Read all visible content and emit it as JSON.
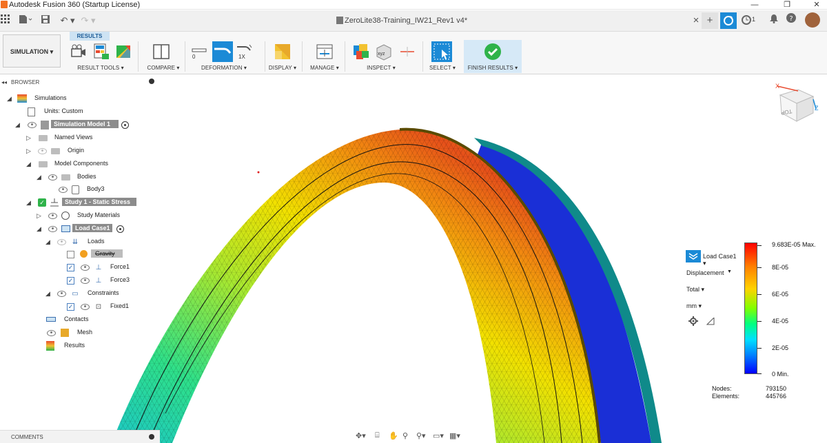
{
  "app": {
    "window_title": "Autodesk Fusion 360 (Startup License)",
    "doc_title": "ZeroLite38-Training_IW21_Rev1 v4*",
    "job_count": "1",
    "window_min": "—",
    "window_max": "❐",
    "window_close": "✕",
    "doc_close": "×",
    "doc_add": "+"
  },
  "ribbon": {
    "workspace": "SIMULATION ▾",
    "active_tab": "RESULTS",
    "groups": {
      "result_tools": "RESULT TOOLS ▾",
      "compare": "COMPARE ▾",
      "deformation": "DEFORMATION ▾",
      "display": "DISPLAY ▾",
      "manage": "MANAGE ▾",
      "inspect": "INSPECT ▾",
      "select": "SELECT ▾",
      "finish": "FINISH RESULTS ▾"
    },
    "deformation_zero": "0",
    "deformation_1x": "1X",
    "inspect_xyz": "xyz"
  },
  "browser": {
    "header": "BROWSER",
    "items": [
      {
        "label": "Simulations"
      },
      {
        "label": "Units: Custom"
      },
      {
        "label": "Simulation Model 1"
      },
      {
        "label": "Named Views"
      },
      {
        "label": "Origin"
      },
      {
        "label": "Model Components"
      },
      {
        "label": "Bodies"
      },
      {
        "label": "Body3"
      },
      {
        "label": "Study 1 - Static Stress"
      },
      {
        "label": "Study Materials"
      },
      {
        "label": "Load Case1"
      },
      {
        "label": "Loads"
      },
      {
        "label": "Gravity"
      },
      {
        "label": "Force1"
      },
      {
        "label": "Force3"
      },
      {
        "label": "Constraints"
      },
      {
        "label": "Fixed1"
      },
      {
        "label": "Contacts"
      },
      {
        "label": "Mesh"
      },
      {
        "label": "Results"
      }
    ]
  },
  "comments": {
    "label": "COMMENTS"
  },
  "viewcube": {
    "top_label": "TOP",
    "x": "X",
    "z": "Z"
  },
  "result_panel": {
    "load_case": "Load Case1 ▾",
    "result_type": "Displacement",
    "component": "Total ▾",
    "units": "mm ▾",
    "legend": {
      "max": "9.683E-05 Max.",
      "v8": "8E-05",
      "v6": "6E-05",
      "v4": "4E-05",
      "v2": "2E-05",
      "min": "0 Min."
    },
    "legend_value_max": 9.683e-05,
    "legend_value_min": 0
  },
  "mesh_stats": {
    "nodes_label": "Nodes:",
    "nodes_value": "793150",
    "elements_label": "Elements:",
    "elements_value": "445766"
  },
  "colors": {
    "accent_blue": "#1b8ad6",
    "finish_green": "#2fb34a",
    "highlight_gray": "#8c8c8c"
  }
}
